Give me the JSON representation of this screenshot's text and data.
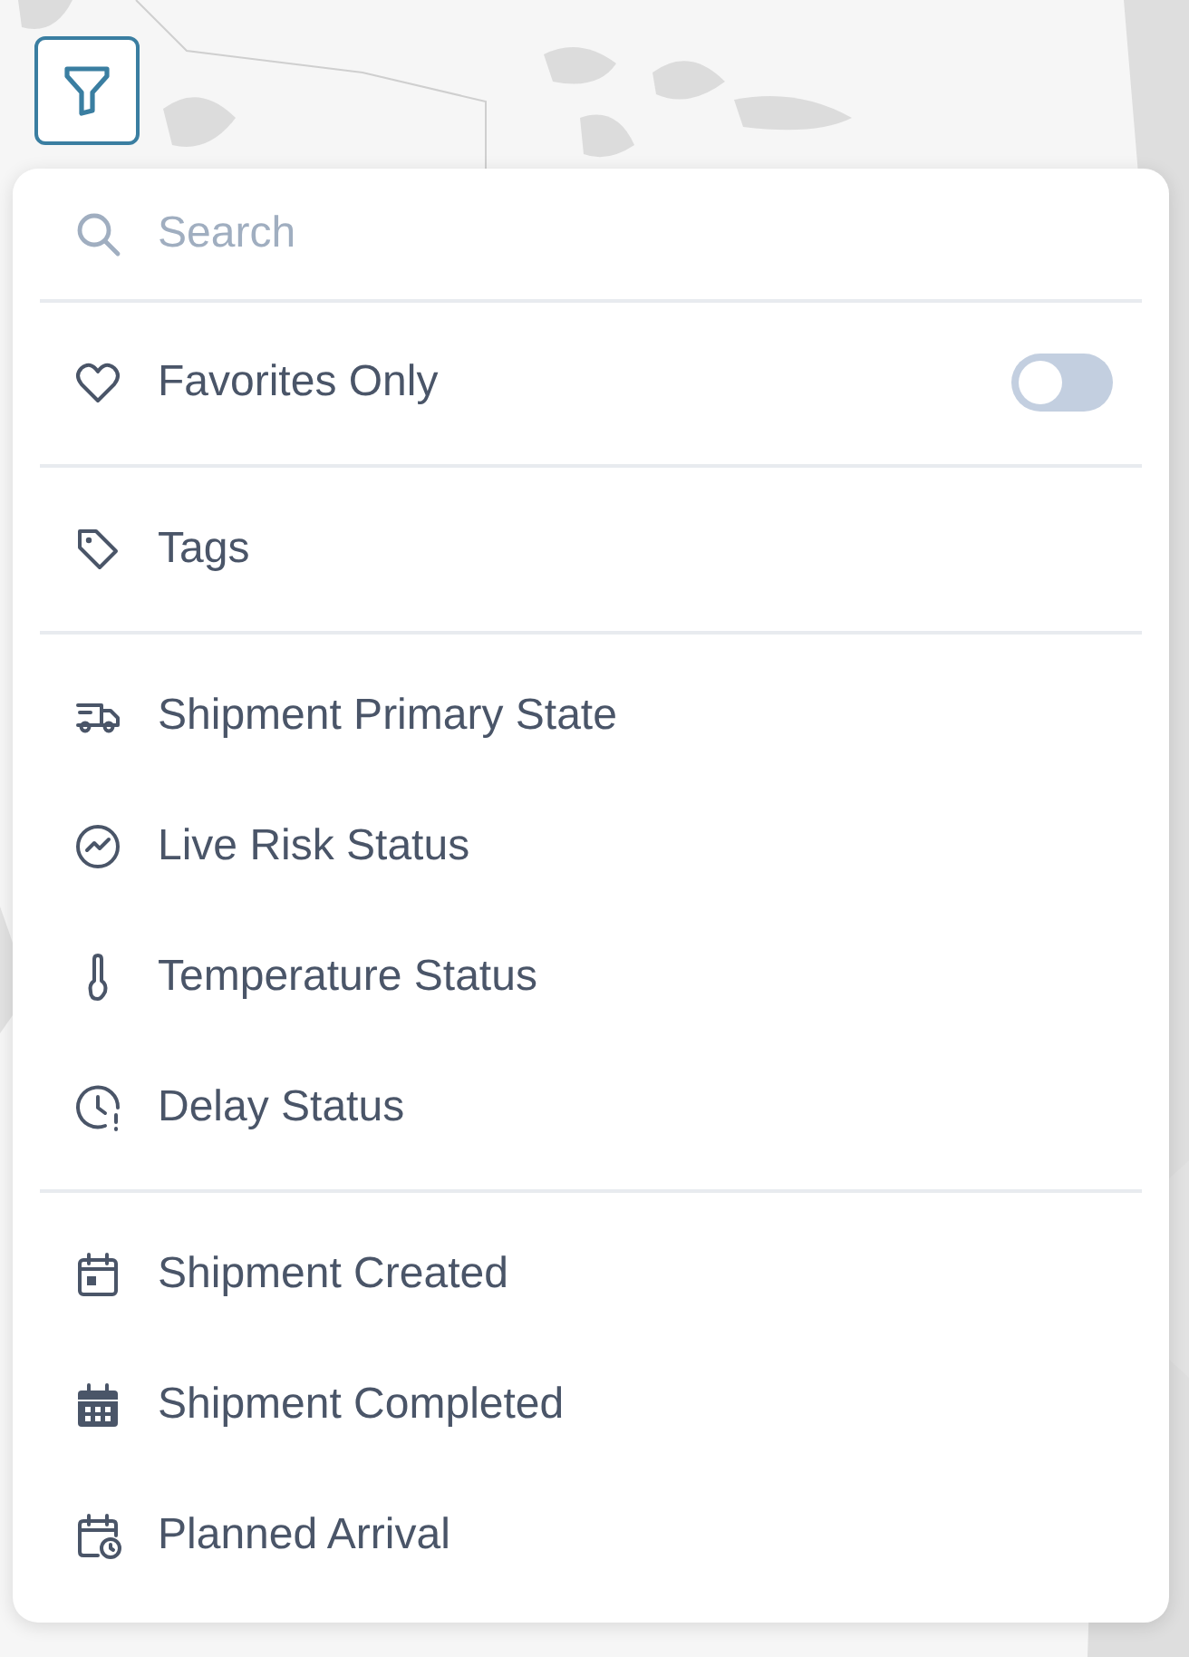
{
  "search": {
    "placeholder": "Search"
  },
  "favorites": {
    "label": "Favorites Only",
    "on": false
  },
  "groups": [
    [
      {
        "label": "Tags"
      }
    ],
    [
      {
        "label": "Shipment Primary State"
      },
      {
        "label": "Live Risk Status"
      },
      {
        "label": "Temperature Status"
      },
      {
        "label": "Delay Status"
      }
    ],
    [
      {
        "label": "Shipment Created"
      },
      {
        "label": "Shipment Completed"
      },
      {
        "label": "Planned Arrival"
      }
    ]
  ]
}
